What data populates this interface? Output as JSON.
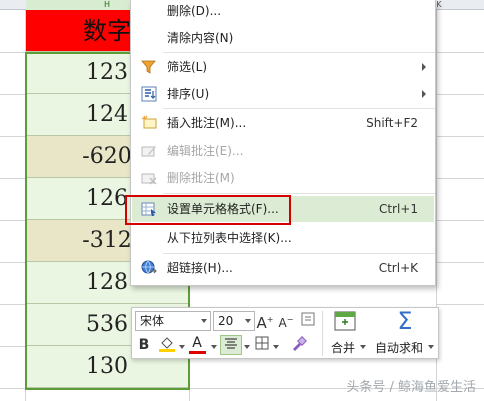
{
  "sheet": {
    "columns": {
      "h": "H",
      "k": "K"
    },
    "header_cell": "数字",
    "cells": [
      "123",
      "124",
      "-620",
      "126",
      "-312",
      "128",
      "536",
      "130"
    ]
  },
  "context_menu": {
    "items": [
      {
        "id": "delete",
        "label": "删除(D)...",
        "shortcut": "",
        "icon": "none",
        "disabled": false,
        "submenu": false
      },
      {
        "id": "clear",
        "label": "清除内容(N)",
        "shortcut": "",
        "icon": "none",
        "disabled": false,
        "submenu": false
      },
      {
        "id": "filter",
        "label": "筛选(L)",
        "shortcut": "",
        "icon": "filter-icon",
        "disabled": false,
        "submenu": true
      },
      {
        "id": "sort",
        "label": "排序(U)",
        "shortcut": "",
        "icon": "sort-icon",
        "disabled": false,
        "submenu": true
      },
      {
        "id": "insert-comment",
        "label": "插入批注(M)...",
        "shortcut": "Shift+F2",
        "icon": "insert-comment-icon",
        "disabled": false,
        "submenu": false
      },
      {
        "id": "edit-comment",
        "label": "编辑批注(E)...",
        "shortcut": "",
        "icon": "edit-comment-icon",
        "disabled": true,
        "submenu": false
      },
      {
        "id": "delete-comment",
        "label": "删除批注(M)",
        "shortcut": "",
        "icon": "delete-comment-icon",
        "disabled": true,
        "submenu": false
      },
      {
        "id": "format-cells",
        "label": "设置单元格格式(F)...",
        "shortcut": "Ctrl+1",
        "icon": "format-cells-icon",
        "disabled": false,
        "submenu": false,
        "highlighted": true
      },
      {
        "id": "pick-list",
        "label": "从下拉列表中选择(K)...",
        "shortcut": "",
        "icon": "none",
        "disabled": false,
        "submenu": false
      },
      {
        "id": "hyperlink",
        "label": "超链接(H)...",
        "shortcut": "Ctrl+K",
        "icon": "hyperlink-icon",
        "disabled": false,
        "submenu": false
      }
    ]
  },
  "toolbar": {
    "font_name": "宋体",
    "font_size": "20",
    "bold_label": "B",
    "merge_label": "合并",
    "autosum_label": "自动求和",
    "colors": {
      "fill": "#ffd200",
      "font": "#e00000"
    }
  },
  "watermark": "头条号 / 鲸海鱼爱生活",
  "colors": {
    "header_fill": "#ff0000",
    "highlight": "#dcebd3",
    "red_box": "#d40000",
    "selection": "#5e9c3a"
  }
}
